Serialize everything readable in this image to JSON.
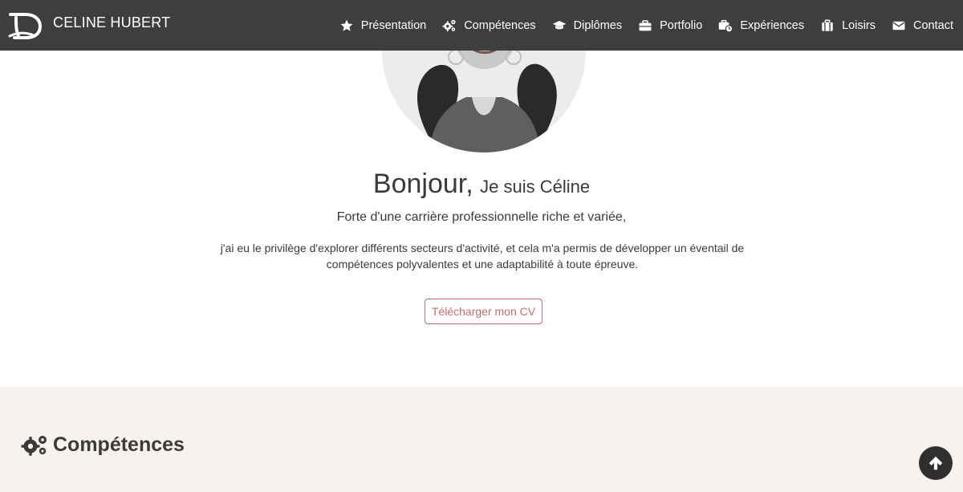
{
  "brand": {
    "name": "CELINE HUBERT",
    "logo_icon": "cd-monogram-logo"
  },
  "nav": {
    "items": [
      {
        "label": "Présentation",
        "icon": "star-icon"
      },
      {
        "label": "Compétences",
        "icon": "cogs-icon"
      },
      {
        "label": "Diplômes",
        "icon": "graduation-cap-icon"
      },
      {
        "label": "Portfolio",
        "icon": "briefcase-icon"
      },
      {
        "label": "Expériences",
        "icon": "briefcase-clock-icon"
      },
      {
        "label": "Loisirs",
        "icon": "suitcase-icon"
      },
      {
        "label": "Contact",
        "icon": "envelope-icon"
      }
    ]
  },
  "hero": {
    "greeting_big": "Bonjour,",
    "greeting_small": "Je suis Céline",
    "subtitle": "Forte d'une carrière professionnelle riche et variée,",
    "bio": "j'ai eu le privilège d'explorer différents secteurs d'activité, et cela m'a permis de développer un éventail de compétences polyvalentes et une adaptabilité à toute épreuve.",
    "cv_button": "Télécharger mon CV"
  },
  "skills": {
    "title": "Compétences",
    "icon": "cogs-icon"
  },
  "back_to_top": {
    "icon": "arrow-up-icon"
  },
  "colors": {
    "navbar": "#3f3e3e",
    "accent": "#c56a6a",
    "section_bg": "#f8f2ef",
    "text": "#3a3a3a"
  }
}
